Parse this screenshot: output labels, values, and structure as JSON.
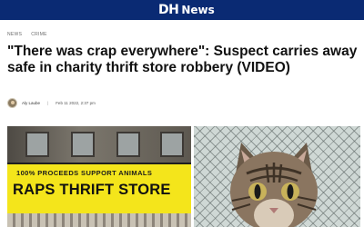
{
  "header": {
    "logo_mark": "DH",
    "logo_text": "News",
    "bg_color": "#0a2a73"
  },
  "breadcrumb": {
    "items": [
      "NEWS",
      "CRIME"
    ]
  },
  "article": {
    "headline": "\"There was crap everywhere\": Suspect carries away safe in charity thrift store robbery (VIDEO)",
    "author": "Aly Laube",
    "date": "Feb 11 2022, 2:37 pm"
  },
  "photos": {
    "left": {
      "sign_top": "100% PROCEEDS SUPPORT ANIMALS",
      "sign_main": "RAPS THRIFT STORE",
      "sign_color": "#f4e51b"
    },
    "right": {
      "subject": "cat"
    }
  }
}
